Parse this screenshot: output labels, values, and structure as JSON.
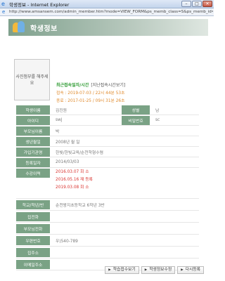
{
  "window": {
    "title": "학생정보 - Internet Explorer",
    "url": "http://www.amsansem.com/admin_member.htm?mode=VIEW_FORM&ps_memb_class=S&ps_memb_id=swj00"
  },
  "header": {
    "title": "학생정보"
  },
  "photo": {
    "text": "사진첨부를 해주세요"
  },
  "login": {
    "heading": "최근접속일자/시간",
    "history_link": "[지난접속시간보기]",
    "lines": [
      "접속 : 2019-07-03 / 22시 44분 53초",
      "종료 : 2017-01-25 / 09시 31분 26초"
    ]
  },
  "fields": {
    "student_name": {
      "label": "학생이름",
      "value": "김진원"
    },
    "gender": {
      "label": "성별",
      "value": "남"
    },
    "user_id": {
      "label": "아이디",
      "value": "swj"
    },
    "password": {
      "label": "비밀번호",
      "value": "sc"
    },
    "parent_name": {
      "label": "부모님이름",
      "value": "박"
    },
    "birthdate": {
      "label": "생년월일",
      "value": "2008년   월   일"
    },
    "member_org": {
      "label": "가입기관명",
      "value": "한빛/한빛교육/순천학형수렴"
    },
    "reg_date": {
      "label": "등록일자",
      "value": "2014/03/03"
    },
    "history": {
      "label": "수강이력",
      "values": [
        "2016.03.07 회 소",
        "2016.05.16 재 등록",
        "2019.03.08 회 소"
      ]
    },
    "school": {
      "label": "학교/학년/반",
      "value": "순천왕지초등학교 6학년 3반"
    },
    "home_phone": {
      "label": "집전화",
      "value": ""
    },
    "parent_phone": {
      "label": "부모님전화",
      "value": ""
    },
    "zipcode": {
      "label": "우편번호",
      "value": "우)540-789"
    },
    "home_address": {
      "label": "집주소",
      "value": ""
    },
    "email": {
      "label": "이메일주소",
      "value": ""
    }
  },
  "buttons": {
    "study_report": "학습접수보기",
    "edit": "학생정보수정",
    "relist": "다시등록"
  },
  "colors": {
    "header_green": "#7ea08c",
    "label_green": "#7aa285",
    "login_green": "#2c9a30",
    "orange": "#e08a2c",
    "red": "#d9302c"
  }
}
